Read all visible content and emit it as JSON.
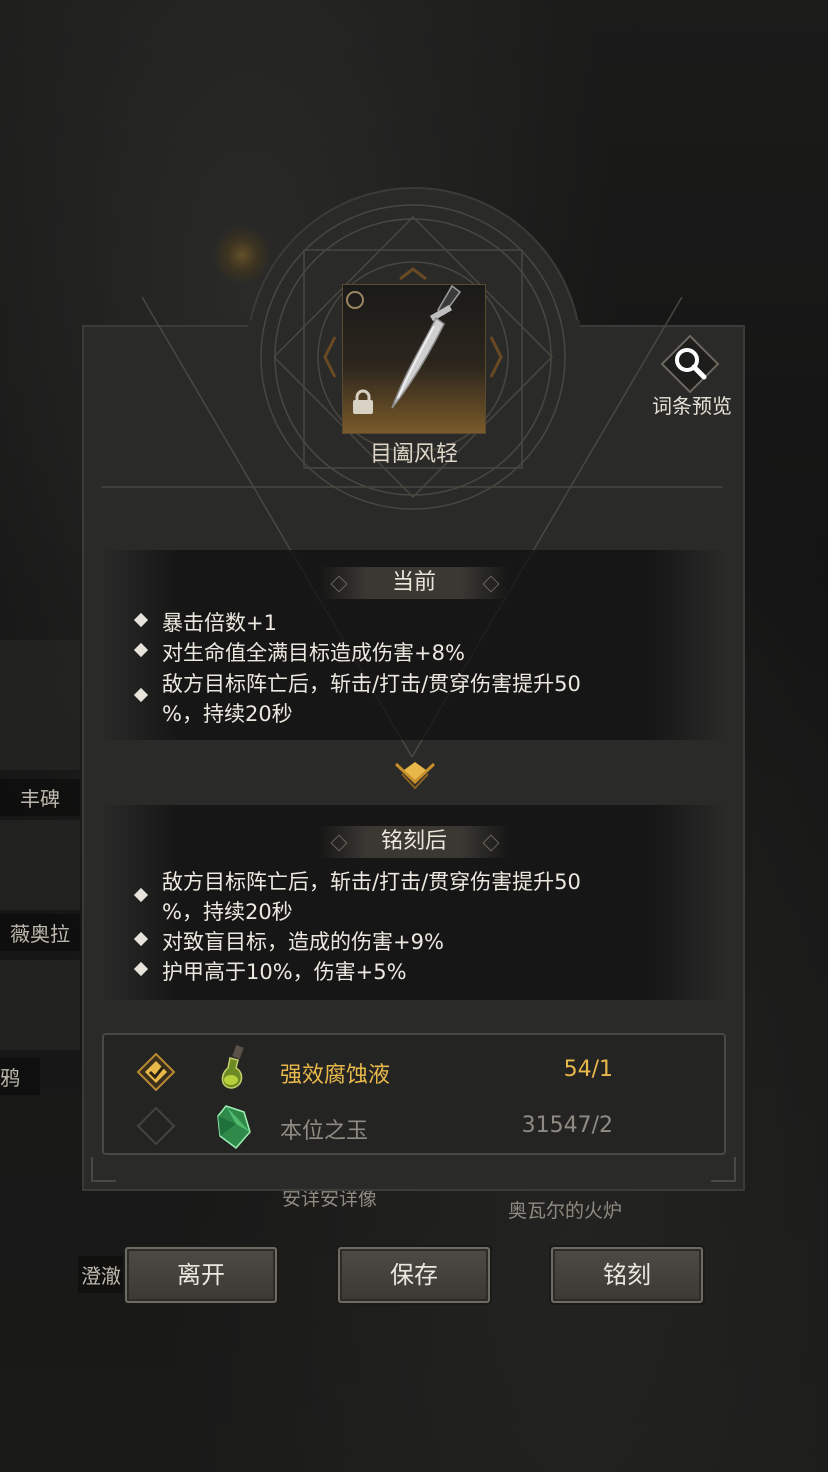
{
  "background": {
    "side_labels": [
      "丰碑",
      "薇奥拉",
      "鸦",
      "澄澈"
    ],
    "bottom_labels": [
      "安详安详像",
      "奥瓦尔的火炉"
    ]
  },
  "item": {
    "name": "目阖风轻",
    "icon": "dagger-icon",
    "locked": true
  },
  "preview": {
    "label": "词条预览",
    "icon": "magnifier-icon"
  },
  "current": {
    "title": "当前",
    "affixes": [
      "暴击倍数+1",
      "对生命值全满目标造成伤害+8%",
      "敌方目标阵亡后，斩击/打击/贯穿伤害提升50",
      "%，持续20秒"
    ]
  },
  "after": {
    "title": "铭刻后",
    "affixes": [
      "敌方目标阵亡后，斩击/打击/贯穿伤害提升50",
      "%，持续20秒",
      "对致盲目标，造成的伤害+9%",
      "护甲高于10%，伤害+5%"
    ]
  },
  "materials": [
    {
      "name": "强效腐蚀液",
      "count": "54/1",
      "selected": true,
      "icon": "potion-icon",
      "color": "#e8b84a"
    },
    {
      "name": "本位之玉",
      "count": "31547/2",
      "selected": false,
      "icon": "green-gem-icon",
      "color": "#8f8b82"
    }
  ],
  "buttons": {
    "leave": "离开",
    "save": "保存",
    "engrave": "铭刻"
  },
  "colors": {
    "accent_gold": "#e8b84a",
    "panel": "#2a2a29"
  }
}
